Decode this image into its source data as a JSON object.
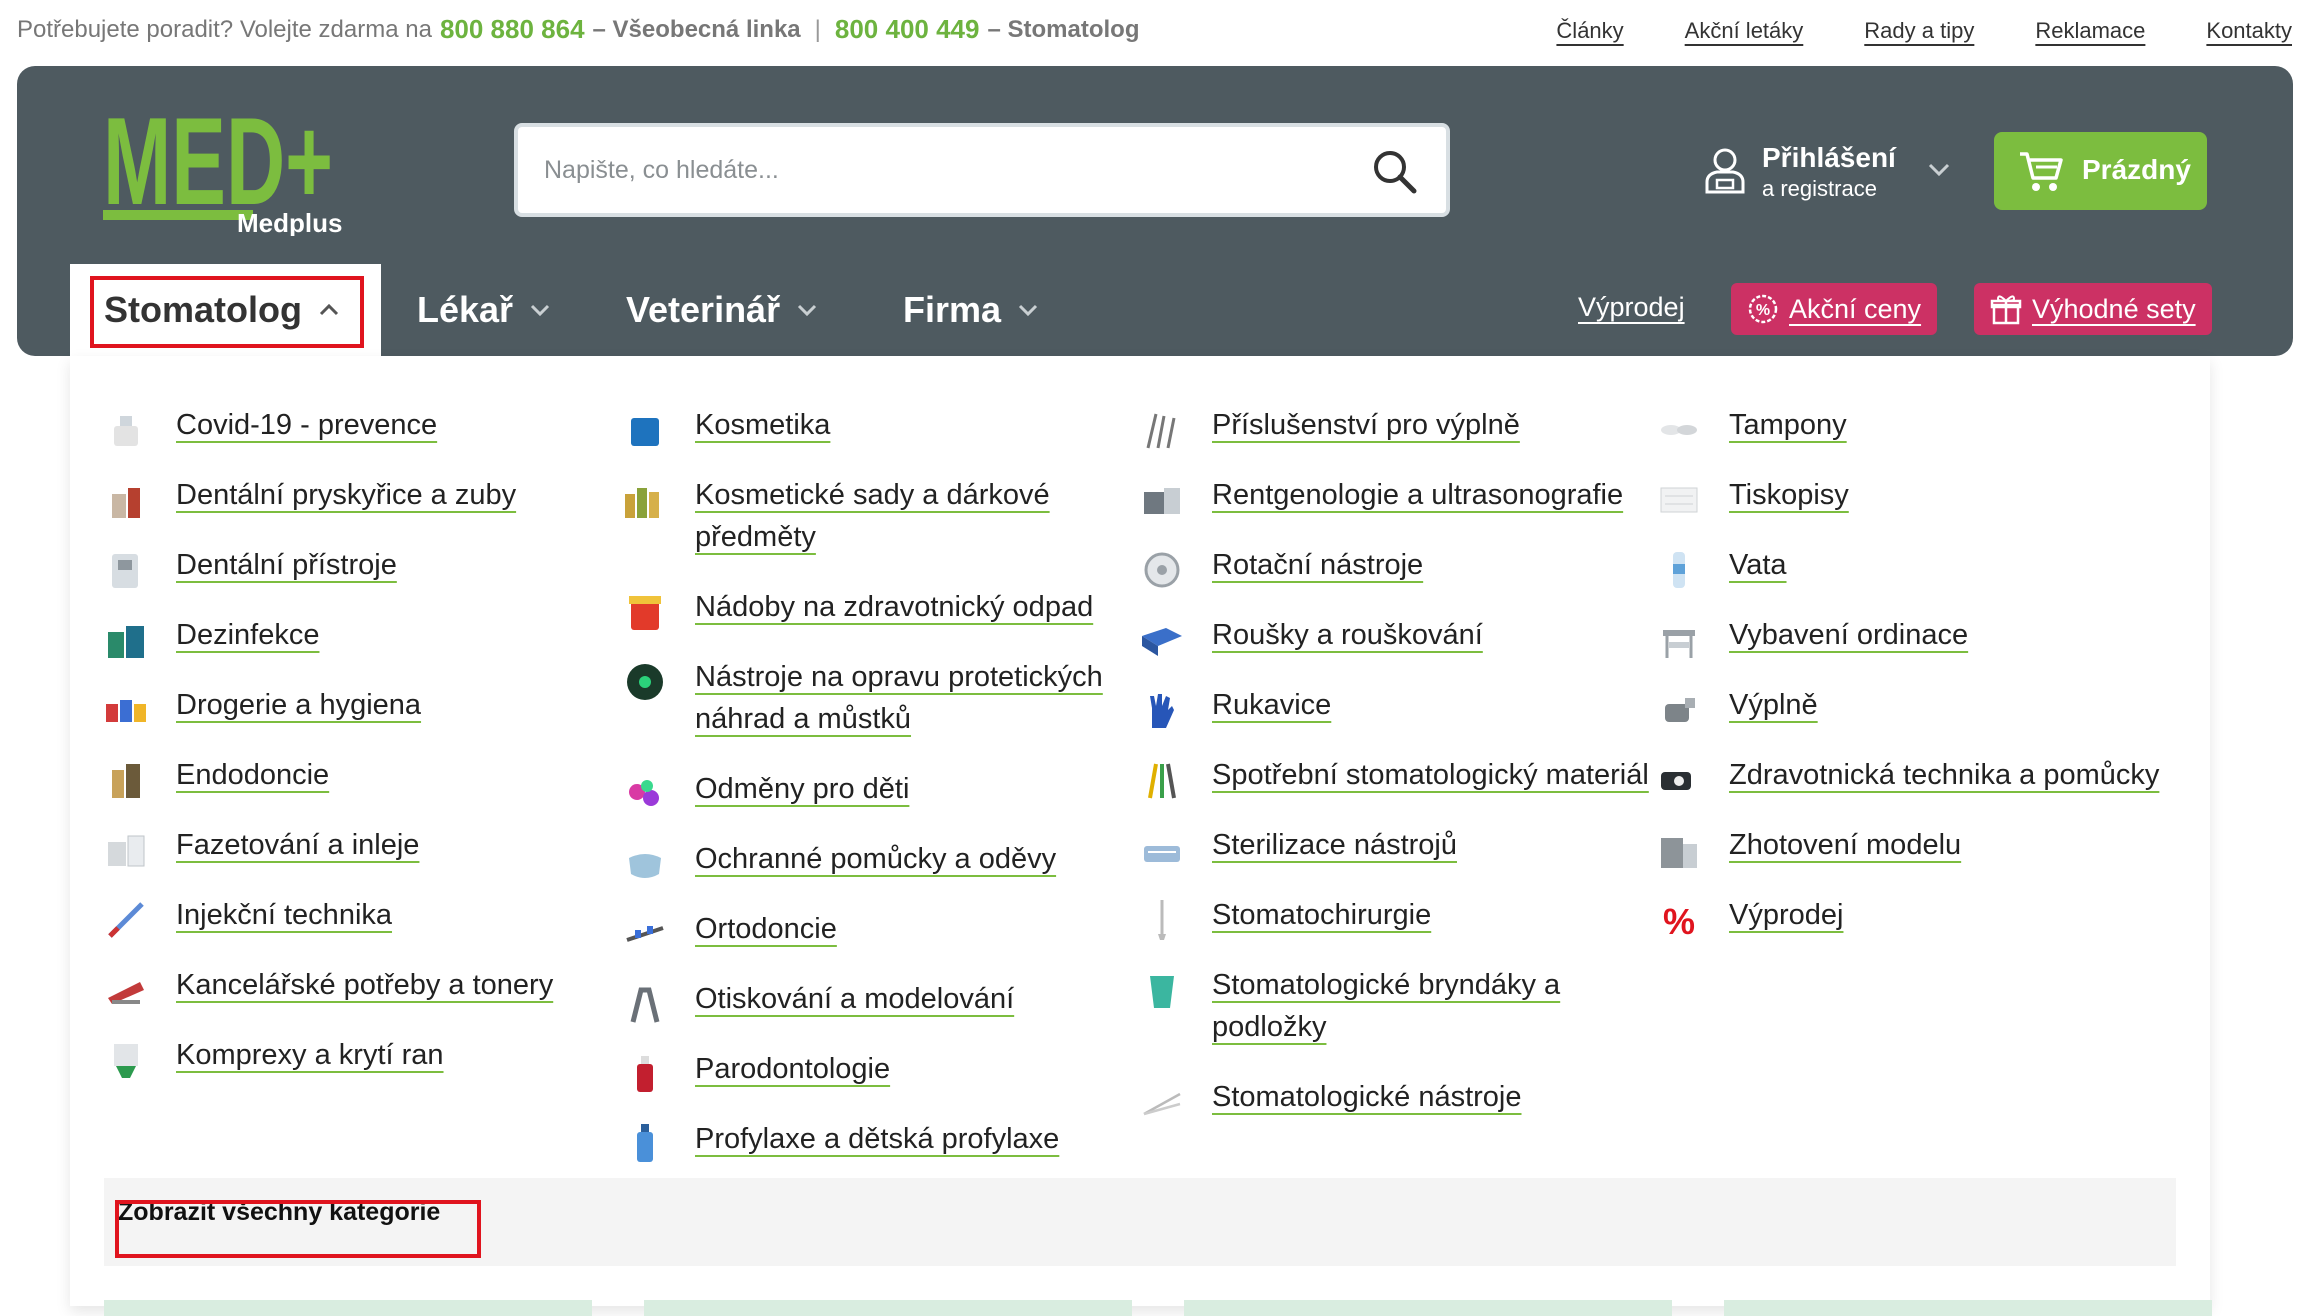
{
  "topbar": {
    "help_text": "Potřebujete poradit? Volejte zdarma na",
    "phone1": "800 880 864",
    "line1": "– Všeobecná linka",
    "separator": "|",
    "phone2": "800 400 449",
    "line2": "– Stomatolog",
    "links": [
      "Články",
      "Akční letáky",
      "Rady a tipy",
      "Reklamace",
      "Kontakty"
    ]
  },
  "logo": {
    "main": "MED+",
    "sub": "Medplus"
  },
  "search": {
    "placeholder": "Napište, co hledáte..."
  },
  "account": {
    "title": "Přihlášení",
    "subtitle": "a registrace"
  },
  "cart": {
    "label": "Prázdný"
  },
  "nav": {
    "items": [
      "Stomatolog",
      "Lékař",
      "Veterinář",
      "Firma"
    ],
    "sale_link": "Výprodej",
    "promo1": "Akční ceny",
    "promo2": "Výhodné sety"
  },
  "categories": {
    "col1": [
      "Covid-19 - prevence",
      "Dentální pryskyřice a zuby",
      "Dentální přístroje",
      "Dezinfekce",
      "Drogerie a hygiena",
      "Endodoncie",
      "Fazetování a inleje",
      "Injekční technika",
      "Kancelářské potřeby a tonery",
      "Komprexy a krytí ran"
    ],
    "col2": [
      "Kosmetika",
      "Kosmetické sady a dárkové předměty",
      "Nádoby na zdravotnický odpad",
      "Nástroje na opravu protetických náhrad a můstků",
      "Odměny pro děti",
      "Ochranné pomůcky a oděvy",
      "Ortodoncie",
      "Otiskování a modelování",
      "Parodontologie",
      "Profylaxe a dětská profylaxe"
    ],
    "col3": [
      "Příslušenství pro výplně",
      "Rentgenologie a ultrasonografie",
      "Rotační nástroje",
      "Roušky a rouškování",
      "Rukavice",
      "Spotřební stomatologický materiál",
      "Sterilizace nástrojů",
      "Stomatochirurgie",
      "Stomatologické bryndáky a podložky",
      "Stomatologické nástroje"
    ],
    "col4": [
      "Tampony",
      "Tiskopisy",
      "Vata",
      "Vybavení ordinace",
      "Výplně",
      "Zdravotnická technika a pomůcky",
      "Zhotovení modelu",
      "Výprodej"
    ],
    "show_all": "Zobrazit všechny kategorie"
  },
  "colors": {
    "header_bg": "#4e5a60",
    "brand_green": "#7cbd3f",
    "promo_pink": "#cc3164",
    "highlight_red": "#e0141e"
  }
}
